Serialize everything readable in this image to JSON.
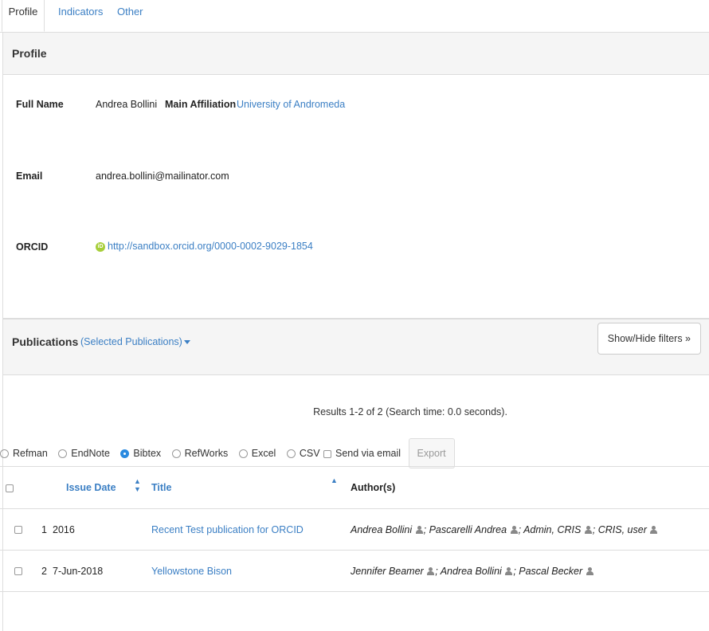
{
  "tabs": [
    {
      "label": "Profile"
    },
    {
      "label": "Indicators"
    },
    {
      "label": "Other"
    }
  ],
  "profile": {
    "heading": "Profile",
    "full_name_label": "Full Name",
    "full_name": "Andrea Bollini",
    "affiliation_label": "Main Affiliation",
    "affiliation": "University of Andromeda",
    "email_label": "Email",
    "email": "andrea.bollini@mailinator.com",
    "orcid_label": "ORCID",
    "orcid_icon_text": "iD",
    "orcid": "http://sandbox.orcid.org/0000-0002-9029-1854"
  },
  "publications": {
    "heading": "Publications",
    "selected": "(Selected Publications)",
    "filters_button": "Show/Hide filters »",
    "results_text": "Results 1-2 of 2 (Search time: 0.0 seconds).",
    "export_options": [
      "Refman",
      "EndNote",
      "Bibtex",
      "RefWorks",
      "Excel",
      "CSV"
    ],
    "export_selected": "Bibtex",
    "send_email": "Send via email",
    "export_button": "Export",
    "columns": {
      "issue_date": "Issue Date",
      "title": "Title",
      "authors": "Author(s)"
    },
    "rows": [
      {
        "num": "1",
        "date": "2016",
        "title": "Recent Test publication for ORCID",
        "authors": [
          "Andrea Bollini",
          "Pascarelli Andrea",
          "Admin, CRIS",
          "CRIS, user"
        ]
      },
      {
        "num": "2",
        "date": "7-Jun-2018",
        "title": "Yellowstone Bison",
        "authors": [
          "Jennifer Beamer",
          "Andrea Bollini",
          "Pascal Becker"
        ]
      }
    ]
  },
  "colors": {
    "link": "#3b7fc4",
    "selected_radio": "#2a8ae0",
    "orcid_green": "#a6ce39"
  }
}
